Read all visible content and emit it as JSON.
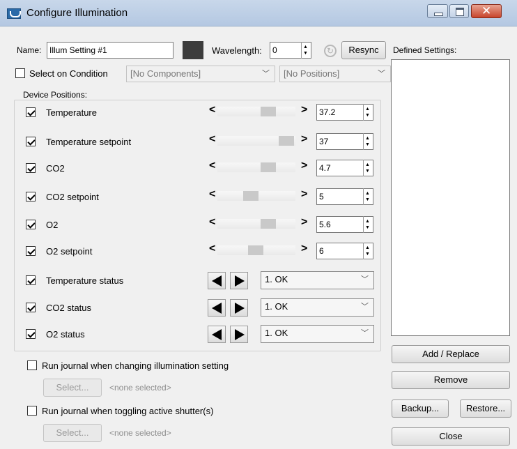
{
  "window": {
    "title": "Configure Illumination"
  },
  "name_label": "Name:",
  "name_value": "Illum Setting #1",
  "wavelength_label": "Wavelength:",
  "wavelength_value": "0",
  "resync_label": "Resync",
  "defined_settings_label": "Defined Settings:",
  "select_condition_label": "Select on Condition",
  "components_combo": "[No Components]",
  "positions_combo": "[No Positions]",
  "device_positions_label": "Device Positions:",
  "devices": [
    {
      "label": "Temperature",
      "checked": true,
      "value": "37.2"
    },
    {
      "label": "Temperature setpoint",
      "checked": true,
      "value": "37"
    },
    {
      "label": "CO2",
      "checked": true,
      "value": "4.7"
    },
    {
      "label": "CO2 setpoint",
      "checked": true,
      "value": "5"
    },
    {
      "label": "O2",
      "checked": true,
      "value": "5.6"
    },
    {
      "label": "O2 setpoint",
      "checked": true,
      "value": "6"
    }
  ],
  "status_devices": [
    {
      "label": "Temperature status",
      "checked": true,
      "value": "1. OK"
    },
    {
      "label": "CO2 status",
      "checked": true,
      "value": "1. OK"
    },
    {
      "label": "O2 status",
      "checked": true,
      "value": "1. OK"
    }
  ],
  "slider_arrows": {
    "left": "<",
    "right": ">"
  },
  "run_journal_illum_label": "Run journal when changing illumination setting",
  "run_journal_shutter_label": "Run journal when toggling active shutter(s)",
  "select_button": "Select...",
  "none_selected": "<none selected>",
  "buttons": {
    "add_replace": "Add / Replace",
    "remove": "Remove",
    "backup": "Backup...",
    "restore": "Restore...",
    "close": "Close"
  },
  "icons": {
    "app": "app-logo-icon",
    "minimize": "minimize-icon",
    "maximize": "maximize-icon",
    "close": "close-icon",
    "wavelength": "wavelength-sync-icon"
  }
}
